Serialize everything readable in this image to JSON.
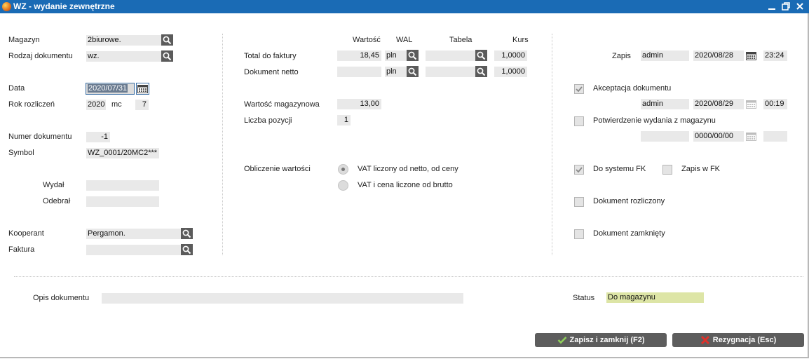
{
  "window": {
    "title": "WZ - wydanie zewnętrzne",
    "controls": [
      "minimize",
      "restore",
      "close"
    ]
  },
  "left": {
    "magazyn_label": "Magazyn",
    "magazyn_value": "2biurowe.",
    "rodzaj_label": "Rodzaj dokumentu",
    "rodzaj_value": "wz.",
    "data_label": "Data",
    "data_value": "2020/07/31",
    "rok_label": "Rok rozliczeń",
    "rok_value": "2020",
    "mc_label": "mc",
    "mc_value": "7",
    "numer_label": "Numer dokumentu",
    "numer_value": "-1",
    "symbol_label": "Symbol",
    "symbol_value": "WZ_0001/20MC2***",
    "wydal_label": "Wydał",
    "wydal_value": "",
    "odebral_label": "Odebrał",
    "odebral_value": "",
    "kooperant_label": "Kooperant",
    "kooperant_value": "Pergamon.",
    "faktura_label": "Faktura",
    "faktura_value": ""
  },
  "middle": {
    "col_wartosc": "Wartość",
    "col_wal": "WAL",
    "col_tabela": "Tabela",
    "col_kurs": "Kurs",
    "total_label": "Total do faktury",
    "total_value": "18,45",
    "total_wal": "pln",
    "total_tabela": "",
    "total_kurs": "1,0000",
    "netto_label": "Dokument netto",
    "netto_value": "",
    "netto_wal": "pln",
    "netto_tabela": "",
    "netto_kurs": "1,0000",
    "magazynowa_label": "Wartość magazynowa",
    "magazynowa_value": "13,00",
    "pozycji_label": "Liczba pozycji",
    "pozycji_value": "1",
    "obliczenie_label": "Obliczenie wartości",
    "radio1_label": "VAT liczony od netto, od ceny",
    "radio2_label": "VAT i cena liczone od brutto",
    "selected_radio": 1
  },
  "right": {
    "zapis_label": "Zapis",
    "zapis_user": "admin",
    "zapis_date": "2020/08/28",
    "zapis_time": "23:24",
    "akceptacja_label": "Akceptacja dokumentu",
    "akceptacja_checked": true,
    "akceptacja_user": "admin",
    "akceptacja_date": "2020/08/29",
    "akceptacja_time": "00:19",
    "potwierdzenie_label": "Potwierdzenie wydania z magazynu",
    "potwierdzenie_checked": false,
    "potwierdzenie_user": "",
    "potwierdzenie_date": "0000/00/00",
    "potwierdzenie_time": "",
    "fk_label": "Do systemu FK",
    "fk_checked": true,
    "zapis_fk_label": "Zapis w FK",
    "zapis_fk_checked": false,
    "rozliczony_label": "Dokument rozliczony",
    "rozliczony_checked": false,
    "zamkniety_label": "Dokument zamknięty",
    "zamkniety_checked": false
  },
  "bottom": {
    "opis_label": "Opis dokumentu",
    "opis_value": "",
    "status_label": "Status",
    "status_value": "Do magazynu",
    "status_color": "#dde5a6",
    "save_label": "Zapisz i zamknij (F2)",
    "cancel_label": "Rezygnacja (Esc)"
  },
  "colors": {
    "titlebar": "#1a6bb5",
    "field": "#e9e9e9",
    "button": "#5d5d5d",
    "save_icon": "#8fcf5a",
    "cancel_icon": "#e0312a"
  }
}
